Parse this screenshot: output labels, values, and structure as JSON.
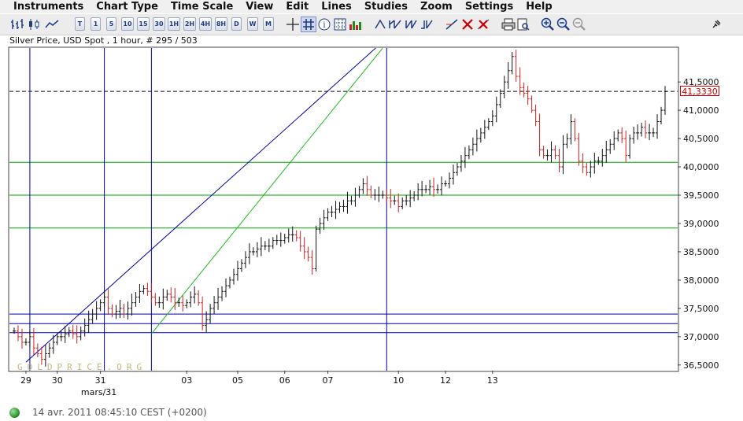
{
  "menu": [
    "Instruments",
    "Chart Type",
    "Time Scale",
    "View",
    "Edit",
    "Lines",
    "Studies",
    "Zoom",
    "Settings",
    "Help"
  ],
  "toolbar": {
    "timeframes": [
      "T",
      "1",
      "5",
      "10",
      "15",
      "30",
      "1H",
      "2H",
      "4H",
      "8H",
      "D",
      "W",
      "M"
    ]
  },
  "chart_title": "Silver Price, USD Spot , 1 hour, # 295 / 503",
  "current_price_label": "41,3330",
  "watermark": "GOLDPRICE.ORG",
  "status_text": "14 avr. 2011 08:45:10  CEST (+0200)",
  "colors": {
    "up_bar": "#111111",
    "down_bar": "#cc2222",
    "horizontal_lines": "#00aa00",
    "trend_lines": "#0000aa",
    "price_marker": "#cc0000"
  },
  "chart_data": {
    "type": "ohlc",
    "series": [
      {
        "name": "Silver Price",
        "values": [
          37.1,
          37.0,
          36.9,
          36.9,
          37.0,
          36.8,
          36.7,
          36.6,
          36.7,
          36.8,
          36.9,
          37.0,
          37.0,
          37.05,
          37.1,
          37.05,
          37.0,
          37.1,
          37.2,
          37.3,
          37.4,
          37.5,
          37.6,
          37.7,
          37.5,
          37.4,
          37.45,
          37.5,
          37.4,
          37.5,
          37.6,
          37.7,
          37.8,
          37.85,
          37.8,
          37.7,
          37.6,
          37.6,
          37.7,
          37.75,
          37.7,
          37.6,
          37.6,
          37.55,
          37.6,
          37.7,
          37.75,
          37.6,
          37.2,
          37.3,
          37.5,
          37.6,
          37.7,
          37.8,
          37.9,
          38.0,
          38.1,
          38.2,
          38.3,
          38.4,
          38.5,
          38.5,
          38.55,
          38.6,
          38.6,
          38.6,
          38.7,
          38.7,
          38.7,
          38.75,
          38.8,
          38.8,
          38.75,
          38.6,
          38.5,
          38.4,
          38.2,
          38.9,
          39.0,
          39.1,
          39.2,
          39.2,
          39.25,
          39.3,
          39.3,
          39.4,
          39.4,
          39.5,
          39.6,
          39.7,
          39.6,
          39.5,
          39.5,
          39.5,
          39.5,
          39.45,
          39.4,
          39.4,
          39.3,
          39.4,
          39.4,
          39.45,
          39.5,
          39.6,
          39.6,
          39.6,
          39.65,
          39.6,
          39.6,
          39.7,
          39.7,
          39.8,
          39.9,
          40.0,
          40.1,
          40.2,
          40.3,
          40.4,
          40.5,
          40.6,
          40.7,
          40.8,
          40.9,
          41.1,
          41.3,
          41.5,
          41.7,
          41.95,
          41.6,
          41.4,
          41.3,
          41.2,
          41.0,
          40.8,
          40.3,
          40.2,
          40.2,
          40.3,
          40.2,
          40.0,
          40.4,
          40.5,
          40.8,
          40.5,
          40.1,
          40.0,
          39.9,
          40.0,
          40.1,
          40.1,
          40.2,
          40.3,
          40.4,
          40.5,
          40.6,
          40.5,
          40.2,
          40.5,
          40.6,
          40.6,
          40.7,
          40.6,
          40.6,
          40.6,
          40.8,
          41.0,
          41.33
        ]
      },
      {
        "name": "",
        "values": []
      }
    ],
    "x_tick_labels": [
      "29",
      "30",
      "31",
      "03",
      "05",
      "06",
      "07",
      "10",
      "12",
      "13"
    ],
    "x_secondary_label": "mars/31",
    "y_tick_labels": [
      "41,5000",
      "41,0000",
      "40,5000",
      "40,0000",
      "39,5000",
      "39,0000",
      "38,5000",
      "38,0000",
      "37,5000",
      "37,0000",
      "36,5000"
    ],
    "ylim": [
      36.4,
      42.1
    ],
    "horizontal_lines": [
      40.08,
      39.5,
      38.92
    ],
    "blue_horizontal_lines": [
      37.4,
      37.23,
      37.07
    ],
    "dashed_price_line": 41.333,
    "vertical_lines_at_index": [
      4,
      23,
      35,
      95
    ],
    "trend_lines": [
      {
        "from": [
          3,
          36.55
        ],
        "to": [
          93,
          42.15
        ]
      },
      {
        "from": [
          35,
          37.05
        ],
        "to": [
          94,
          42.1
        ]
      }
    ]
  }
}
